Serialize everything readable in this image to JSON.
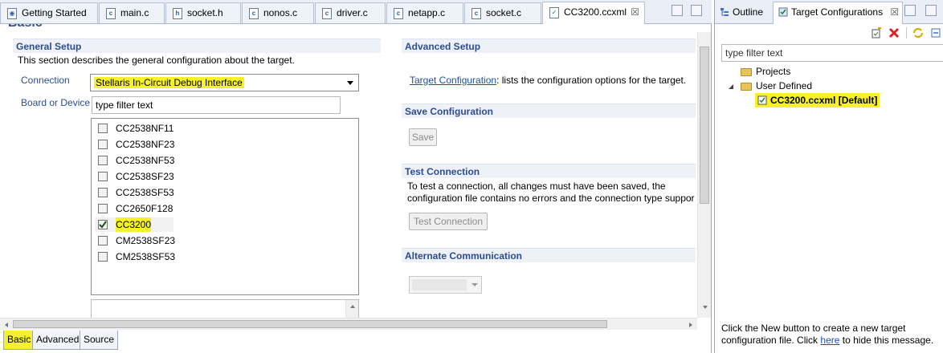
{
  "editor": {
    "tabs": [
      {
        "label": "Getting Started",
        "icon": "web-page-icon"
      },
      {
        "label": "main.c",
        "icon": "c-file-icon"
      },
      {
        "label": "socket.h",
        "icon": "h-file-icon"
      },
      {
        "label": "nonos.c",
        "icon": "c-file-icon"
      },
      {
        "label": "driver.c",
        "icon": "c-file-icon"
      },
      {
        "label": "netapp.c",
        "icon": "c-file-icon"
      },
      {
        "label": "socket.c",
        "icon": "c-file-icon"
      },
      {
        "label": "CC3200.ccxml",
        "icon": "target-config-icon",
        "active": true
      }
    ],
    "close_glyph": "☒"
  },
  "page": {
    "title": "Basic"
  },
  "general_setup": {
    "title": "General Setup",
    "description": "This section describes the general configuration about the target.",
    "connection_label": "Connection",
    "connection_value": "Stellaris In-Circuit Debug Interface",
    "board_label": "Board or Device",
    "filter_placeholder": "type filter text",
    "devices": [
      {
        "name": "CC2538NF11",
        "checked": false
      },
      {
        "name": "CC2538NF23",
        "checked": false
      },
      {
        "name": "CC2538NF53",
        "checked": false
      },
      {
        "name": "CC2538SF23",
        "checked": false
      },
      {
        "name": "CC2538SF53",
        "checked": false
      },
      {
        "name": "CC2650F128",
        "checked": false
      },
      {
        "name": "CC3200",
        "checked": true
      },
      {
        "name": "CM2538SF23",
        "checked": false
      },
      {
        "name": "CM2538SF53",
        "checked": false
      }
    ]
  },
  "advanced_setup": {
    "title": "Advanced Setup",
    "link_text": "Target Configuration",
    "link_rest": ": lists the configuration options for the target."
  },
  "save_configuration": {
    "title": "Save Configuration",
    "button": "Save"
  },
  "test_connection": {
    "title": "Test Connection",
    "line1": "To test a connection, all changes must have been saved, the",
    "line2": "configuration file contains no errors and the connection type suppor",
    "button": "Test Connection"
  },
  "alternate_communication": {
    "title": "Alternate Communication"
  },
  "bottom_tabs": [
    "Basic",
    "Advanced",
    "Source"
  ],
  "right_panel": {
    "tabs": [
      {
        "label": "Outline",
        "icon": "outline-icon"
      },
      {
        "label": "Target Configurations",
        "icon": "target-configurations-icon",
        "active": true
      }
    ],
    "filter_placeholder": "type filter text",
    "tree": {
      "projects": "Projects",
      "user_defined": "User Defined",
      "selected": "CC3200.ccxml [Default]"
    },
    "hint_line1": "Click the New button to create a new target",
    "hint_line2_pre": "configuration file. Click ",
    "hint_link": "here",
    "hint_line2_post": " to hide this message."
  },
  "colors": {
    "highlight": "#f6f227",
    "section_title": "#2c4d8f",
    "link": "#1f4fa8"
  }
}
